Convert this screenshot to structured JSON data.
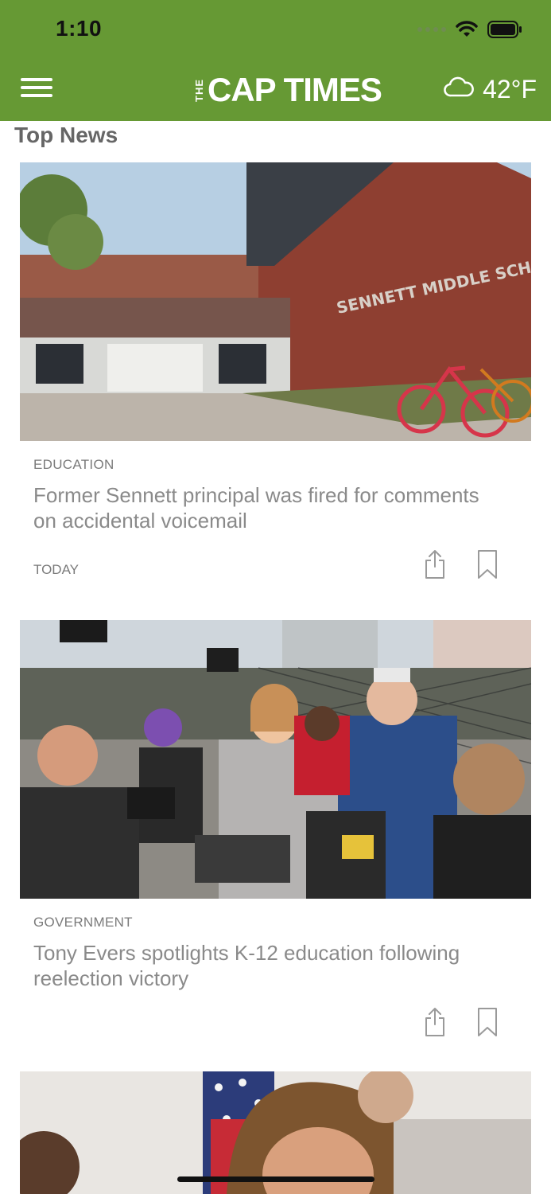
{
  "colors": {
    "brand": "#669934",
    "text_muted": "#8a8a8a"
  },
  "status_bar": {
    "time": "1:10"
  },
  "header": {
    "logo_the": "THE",
    "logo_main": "CAP TIMES",
    "weather_icon": "cloud-icon",
    "temperature": "42°F"
  },
  "section": {
    "title": "Top News"
  },
  "articles": [
    {
      "category": "EDUCATION",
      "headline": "Former Sennett principal was fired for comments on accidental voicemail",
      "date": "TODAY",
      "image_sign": "SENNETT MIDDLE SCHOOL"
    },
    {
      "category": "GOVERNMENT",
      "headline": "Tony Evers spotlights K-12 education following reelection victory",
      "date": ""
    }
  ]
}
